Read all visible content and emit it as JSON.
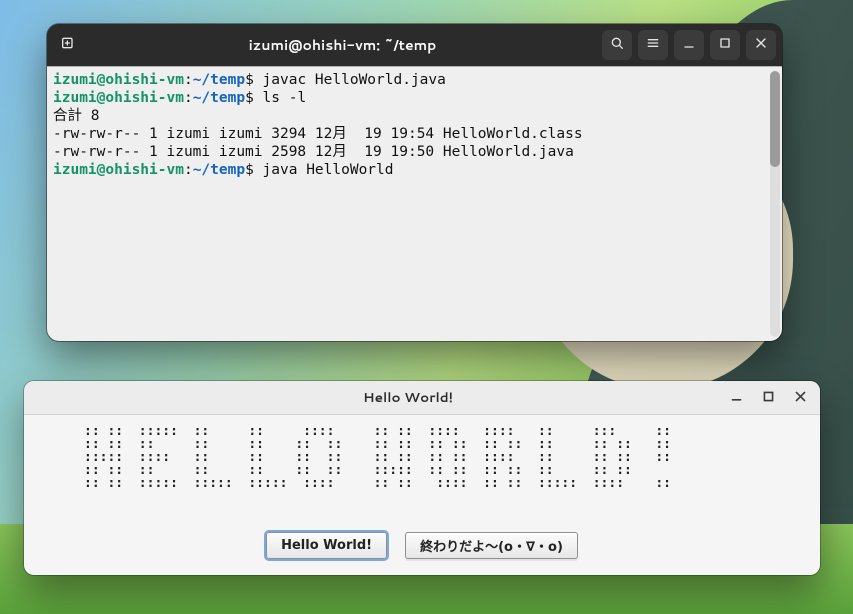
{
  "terminal": {
    "title": "izumi@ohishi-vm: ~/temp",
    "prompt": {
      "userhost": "izumi@ohishi-vm",
      "sep": ":",
      "path": "~/temp",
      "sigil": "$ "
    },
    "lines": {
      "cmd1": "javac HelloWorld.java",
      "cmd2": "ls -l",
      "out_total": "合計 8",
      "out_row1": "-rw-rw-r-- 1 izumi izumi 3294 12月  19 19:54 HelloWorld.class",
      "out_row2": "-rw-rw-r-- 1 izumi izumi 2598 12月  19 19:50 HelloWorld.java",
      "cmd3": "java HelloWorld"
    },
    "titlebar_icons": {
      "newtab": "new-tab-icon",
      "search": "search-icon",
      "menu": "hamburger-icon",
      "minimize": "minimize-icon",
      "maximize": "maximize-icon",
      "close": "close-icon"
    }
  },
  "swing": {
    "title": "Hello World!",
    "ascii_rows": [
      ":: ::  :::::  ::     ::     ::::     :: ::  ::::   ::::   ::     :::     ::",
      ":: ::  ::     ::     ::    ::  ::    :: ::  :: ::  :: ::  ::     :: ::   ::",
      ":::::  ::::   ::     ::    ::  ::    :: ::  :: ::  ::::   ::     :: ::   ::",
      ":: ::  ::     ::     ::    ::  ::    :::::  :: ::  :: ::  ::     :: ::     ",
      ":: ::  :::::  :::::  :::::  ::::     :: ::   ::::  :: ::  :::::  ::::    ::"
    ],
    "buttons": {
      "hello": "Hello World!",
      "owari": "終わりだよ～(o・∇・o)"
    }
  }
}
